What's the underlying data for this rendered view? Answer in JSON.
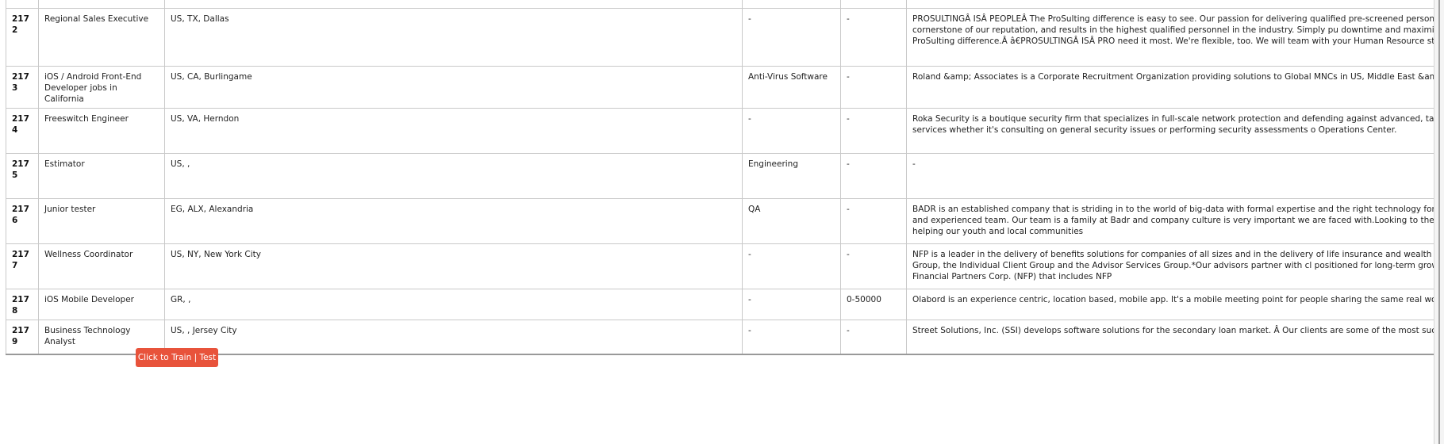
{
  "table": {
    "rows": [
      {
        "id": "2172",
        "title": "Regional Sales Executive",
        "location": "US, TX, Dallas",
        "department": "-",
        "salary": "-",
        "description": "PROSULTINGÂ ISÂ PEOPLEÂ The ProSulting difference is easy to see. Our passion for delivering qualified pre-screened personnel who are ready to fact, our stringent screening process is the cornerstone of our reputation, and results in the highest qualified personnel in the industry. Simply pu downtime and maximizing productivity. Let our staffing agents work for you and experience the ProSulting difference.Â â€PROSULTINGÂ ISÂ PRO need it most. We're flexible, too. We will team with your Human Resource staff and take on the day-to-day search functions, enabling your comp"
      },
      {
        "id": "2173",
        "title": "iOS / Android Front-End Developer jobs in California",
        "location": "US, CA, Burlingame",
        "department": "Anti-Virus Software",
        "salary": "-",
        "description": "Roland &amp; Associates is a Corporate Recruitment Organization providing solutions to Global MNCs in US, Middle East &amp; Asia Pacific for t"
      },
      {
        "id": "2174",
        "title": "Freeswitch Engineer",
        "location": "US, VA, Herndon",
        "department": "-",
        "salary": "-",
        "description": "Roka Security is a boutique security firm that specializes in full-scale network protection and defending against advanced, targeted attacks. Ou data, We help our clients with the full breadth of services whether it's consulting on general security issues or performing security assessments o Operations Center."
      },
      {
        "id": "2175",
        "title": "Estimator",
        "location": "US, ,",
        "department": "Engineering",
        "salary": "-",
        "description": "-"
      },
      {
        "id": "2176",
        "title": "Junior tester",
        "location": "EG, ALX, Alexandria",
        "department": "QA",
        "salary": "-",
        "description": "BADR is an established company that is striding in to the world of big-data with formal expertise and the right technology for the job. Our vision to the field, we have the advantage of a dedicated and experienced team. Our team is a family at Badr and company culture is very important we are faced with.Looking to the present as well as the future, our company is extremely dedicated in helping our youth and local communities"
      },
      {
        "id": "2177",
        "title": "Wellness Coordinator",
        "location": "US, NY, New York City",
        "department": "-",
        "salary": "-",
        "description": "NFP is a leader in the delivery of benefits solutions for companies of all sizes and in the delivery of life insurance and wealth management soluti net worth individual clients: the Corporate Client Group, the Individual Client Group and the Advisor Services Group.*Our advisors partner with cl positioned for long-term growth.*NFP Advisor Services Group is a business segment of National Financial Partners Corp. (NFP) that includes NFP"
      },
      {
        "id": "2178",
        "title": "iOS Mobile Developer",
        "location": "GR, ,",
        "department": "-",
        "salary": "0-50000",
        "description": "Olabord is an experience centric, location based, mobile app. It's a mobile meeting point for people sharing the same real world experience! We"
      },
      {
        "id": "2179",
        "title": "Business Technology Analyst",
        "location": "US, , Jersey City",
        "department": "-",
        "salary": "-",
        "description": "Street Solutions, Inc. (SSI) develops software solutions for the secondary loan market. Â Our clients are some of the most successful investment need to succeed."
      }
    ]
  },
  "actions": {
    "train_test_label": "Click to Train | Test"
  },
  "colors": {
    "button_bg": "#e8533b",
    "border": "#c9c9c9"
  }
}
